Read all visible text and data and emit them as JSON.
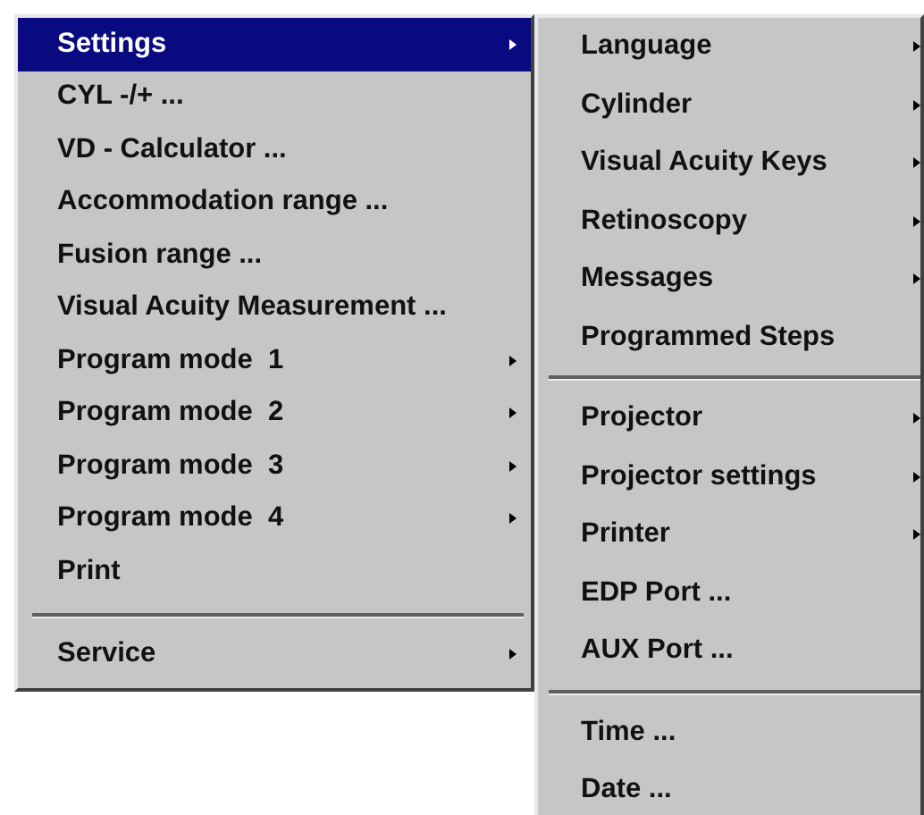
{
  "main_menu": {
    "items": [
      {
        "kind": "item",
        "label": "Settings",
        "submenu": true,
        "selected": true
      },
      {
        "kind": "item",
        "label": "CYL -/+ ...",
        "submenu": false,
        "selected": false
      },
      {
        "kind": "item",
        "label": "VD - Calculator ...",
        "submenu": false,
        "selected": false
      },
      {
        "kind": "item",
        "label": "Accommodation range ...",
        "submenu": false,
        "selected": false
      },
      {
        "kind": "item",
        "label": "Fusion range ...",
        "submenu": false,
        "selected": false
      },
      {
        "kind": "item",
        "label": "Visual Acuity Measurement ...",
        "submenu": false,
        "selected": false
      },
      {
        "kind": "item",
        "label": "Program mode  1",
        "submenu": true,
        "selected": false
      },
      {
        "kind": "item",
        "label": "Program mode  2",
        "submenu": true,
        "selected": false
      },
      {
        "kind": "item",
        "label": "Program mode  3",
        "submenu": true,
        "selected": false
      },
      {
        "kind": "item",
        "label": "Program mode  4",
        "submenu": true,
        "selected": false
      },
      {
        "kind": "item",
        "label": "Print",
        "submenu": false,
        "selected": false
      },
      {
        "kind": "separator"
      },
      {
        "kind": "item",
        "label": "Service",
        "submenu": true,
        "selected": false
      }
    ]
  },
  "settings_submenu": {
    "items": [
      {
        "kind": "item",
        "label": "Language",
        "submenu": true,
        "selected": false
      },
      {
        "kind": "item",
        "label": "Cylinder",
        "submenu": true,
        "selected": false
      },
      {
        "kind": "item",
        "label": "Visual Acuity Keys",
        "submenu": true,
        "selected": false
      },
      {
        "kind": "item",
        "label": "Retinoscopy",
        "submenu": true,
        "selected": false
      },
      {
        "kind": "item",
        "label": "Messages",
        "submenu": true,
        "selected": false
      },
      {
        "kind": "item",
        "label": "Programmed Steps",
        "submenu": false,
        "selected": false
      },
      {
        "kind": "separator"
      },
      {
        "kind": "item",
        "label": "Projector",
        "submenu": true,
        "selected": false
      },
      {
        "kind": "item",
        "label": "Projector settings",
        "submenu": true,
        "selected": false
      },
      {
        "kind": "item",
        "label": "Printer",
        "submenu": true,
        "selected": false
      },
      {
        "kind": "item",
        "label": "EDP Port ...",
        "submenu": false,
        "selected": false
      },
      {
        "kind": "item",
        "label": "AUX Port ...",
        "submenu": false,
        "selected": false
      },
      {
        "kind": "separator"
      },
      {
        "kind": "item",
        "label": "Time ...",
        "submenu": false,
        "selected": false
      },
      {
        "kind": "item",
        "label": "Date ...",
        "submenu": false,
        "selected": false
      }
    ]
  }
}
